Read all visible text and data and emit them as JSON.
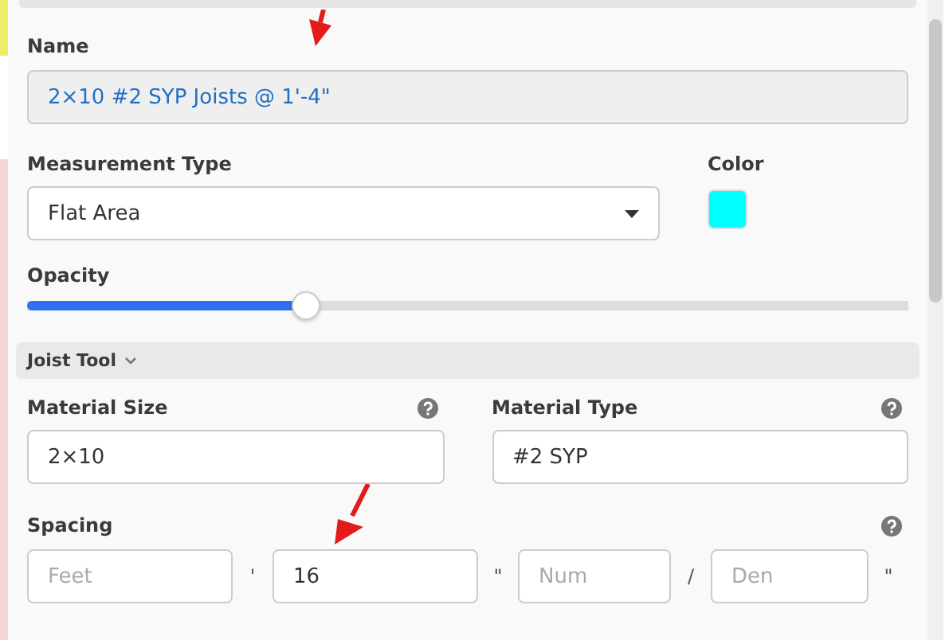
{
  "name_field": {
    "label": "Name",
    "value": "2×10 #2 SYP Joists @ 1'-4\""
  },
  "measurement_type": {
    "label": "Measurement Type",
    "value": "Flat Area"
  },
  "color": {
    "label": "Color",
    "color": "#00ffff"
  },
  "opacity": {
    "label": "Opacity",
    "level": 0.317
  },
  "section": {
    "title": "Joist Tool",
    "expanded": true
  },
  "material_size": {
    "label": "Material Size",
    "value": "2×10"
  },
  "material_type": {
    "label": "Material Type",
    "value": "#2 SYP"
  },
  "spacing": {
    "label": "Spacing",
    "fields": [
      {
        "placeholder": "Feet",
        "unit": "'"
      },
      {
        "value": "16",
        "unit": "\""
      },
      {
        "placeholder": "Num",
        "unit": "/"
      },
      {
        "placeholder": "Den",
        "unit": "\""
      }
    ]
  }
}
